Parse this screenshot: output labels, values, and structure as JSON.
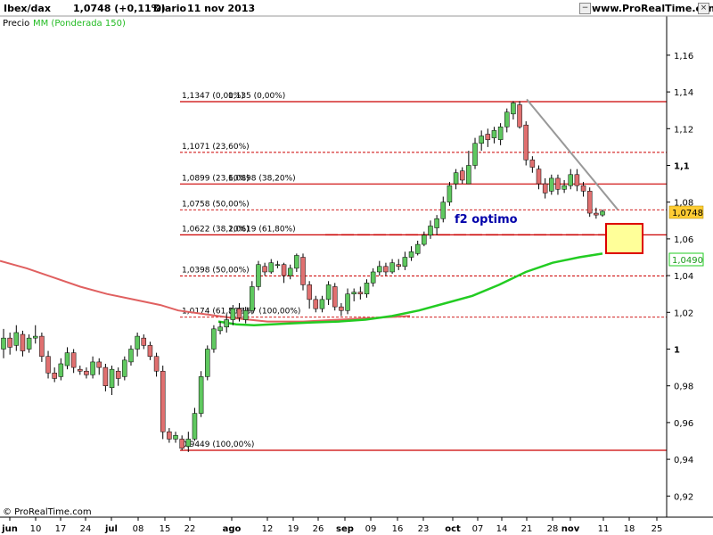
{
  "header": {
    "symbol": "Ibex/dax",
    "last": "1,0748 (+0,11%)",
    "period": "Diario",
    "date": "11 nov 2013",
    "site": "www.ProRealTime.com"
  },
  "legend": {
    "price_label": "Precio",
    "ma_label": "MM (Ponderada 150)"
  },
  "footer": {
    "copyright": "© ProRealTime.com"
  },
  "colors": {
    "up": "#5fc85f",
    "down": "#e07070",
    "level_line": "#cc0000",
    "ma_short": "#22cc22",
    "ma_long": "#e06060",
    "trend": "#999999",
    "highlight_fill": "#ffff99",
    "highlight_border": "#dd0000",
    "annotation": "#0000aa",
    "price_tag": "#ffcc33"
  },
  "chart_data": {
    "type": "candlestick",
    "ylim": [
      0.905,
      1.175
    ],
    "x_ticks": [
      "jun",
      "10",
      "17",
      "24",
      "jul",
      "08",
      "15",
      "22",
      "ago",
      "12",
      "19",
      "26",
      "sep",
      "09",
      "16",
      "23",
      "oct",
      "07",
      "14",
      "21",
      "28",
      "nov",
      "11",
      "18",
      "25"
    ],
    "bold_ticks": [
      "jun",
      "jul",
      "ago",
      "sep",
      "oct",
      "nov"
    ],
    "y_ticks": [
      "1,16",
      "1,14",
      "1,12",
      "1,1",
      "1,08",
      "1,06",
      "1,04",
      "1,02",
      "1",
      "0,98",
      "0,96",
      "0,94",
      "0,92"
    ],
    "y_tick_values": [
      1.16,
      1.14,
      1.12,
      1.1,
      1.08,
      1.06,
      1.04,
      1.02,
      1.0,
      0.98,
      0.96,
      0.94,
      0.92
    ],
    "candles": [
      [
        1.0,
        1.006,
        1.011,
        0.995
      ],
      [
        1.006,
        1.001,
        1.009,
        0.997
      ],
      [
        1.002,
        1.009,
        1.013,
        0.999
      ],
      [
        1.008,
        0.999,
        1.01,
        0.996
      ],
      [
        1.0,
        1.006,
        1.008,
        0.998
      ],
      [
        1.006,
        1.007,
        1.013,
        1.003
      ],
      [
        1.007,
        0.996,
        1.009,
        0.993
      ],
      [
        0.996,
        0.987,
        0.999,
        0.984
      ],
      [
        0.987,
        0.984,
        0.99,
        0.982
      ],
      [
        0.985,
        0.992,
        0.995,
        0.983
      ],
      [
        0.991,
        0.998,
        1.001,
        0.989
      ],
      [
        0.998,
        0.99,
        1.0,
        0.987
      ],
      [
        0.989,
        0.988,
        0.991,
        0.986
      ],
      [
        0.988,
        0.986,
        0.99,
        0.984
      ],
      [
        0.986,
        0.993,
        0.996,
        0.984
      ],
      [
        0.993,
        0.99,
        0.995,
        0.986
      ],
      [
        0.99,
        0.98,
        0.992,
        0.977
      ],
      [
        0.979,
        0.989,
        0.991,
        0.975
      ],
      [
        0.988,
        0.984,
        0.99,
        0.98
      ],
      [
        0.985,
        0.994,
        0.996,
        0.983
      ],
      [
        0.993,
        1.0,
        1.002,
        0.991
      ],
      [
        1.0,
        1.007,
        1.009,
        0.996
      ],
      [
        1.006,
        1.002,
        1.008,
        1.0
      ],
      [
        1.002,
        0.996,
        1.004,
        0.994
      ],
      [
        0.996,
        0.988,
        0.998,
        0.985
      ],
      [
        0.988,
        0.955,
        0.991,
        0.951
      ],
      [
        0.955,
        0.951,
        0.957,
        0.949
      ],
      [
        0.951,
        0.953,
        0.955,
        0.949
      ],
      [
        0.951,
        0.946,
        0.953,
        0.945
      ],
      [
        0.947,
        0.951,
        0.955,
        0.944
      ],
      [
        0.951,
        0.965,
        0.968,
        0.95
      ],
      [
        0.965,
        0.985,
        0.988,
        0.963
      ],
      [
        0.985,
        1.0,
        1.002,
        0.983
      ],
      [
        1.0,
        1.011,
        1.013,
        0.998
      ],
      [
        1.01,
        1.012,
        1.015,
        1.008
      ],
      [
        1.012,
        1.016,
        1.019,
        1.009
      ],
      [
        1.016,
        1.022,
        1.024,
        1.013
      ],
      [
        1.022,
        1.017,
        1.025,
        1.015
      ],
      [
        1.016,
        1.021,
        1.023,
        1.014
      ],
      [
        1.021,
        1.034,
        1.037,
        1.019
      ],
      [
        1.034,
        1.046,
        1.048,
        1.032
      ],
      [
        1.045,
        1.042,
        1.047,
        1.04
      ],
      [
        1.042,
        1.047,
        1.049,
        1.041
      ],
      [
        1.046,
        1.046,
        1.048,
        1.044
      ],
      [
        1.046,
        1.04,
        1.047,
        1.036
      ],
      [
        1.04,
        1.044,
        1.046,
        1.038
      ],
      [
        1.044,
        1.051,
        1.052,
        1.042
      ],
      [
        1.05,
        1.035,
        1.052,
        1.032
      ],
      [
        1.035,
        1.027,
        1.037,
        1.022
      ],
      [
        1.027,
        1.022,
        1.029,
        1.02
      ],
      [
        1.022,
        1.027,
        1.029,
        1.02
      ],
      [
        1.027,
        1.035,
        1.037,
        1.024
      ],
      [
        1.034,
        1.023,
        1.036,
        1.021
      ],
      [
        1.023,
        1.021,
        1.025,
        1.018
      ],
      [
        1.021,
        1.03,
        1.033,
        1.019
      ],
      [
        1.03,
        1.031,
        1.033,
        1.026
      ],
      [
        1.031,
        1.03,
        1.034,
        1.027
      ],
      [
        1.03,
        1.036,
        1.038,
        1.028
      ],
      [
        1.036,
        1.042,
        1.044,
        1.034
      ],
      [
        1.042,
        1.045,
        1.048,
        1.04
      ],
      [
        1.045,
        1.042,
        1.047,
        1.04
      ],
      [
        1.042,
        1.047,
        1.049,
        1.041
      ],
      [
        1.046,
        1.045,
        1.049,
        1.043
      ],
      [
        1.045,
        1.05,
        1.053,
        1.043
      ],
      [
        1.05,
        1.053,
        1.056,
        1.048
      ],
      [
        1.052,
        1.057,
        1.059,
        1.051
      ],
      [
        1.057,
        1.062,
        1.064,
        1.056
      ],
      [
        1.062,
        1.067,
        1.07,
        1.06
      ],
      [
        1.066,
        1.071,
        1.073,
        1.062
      ],
      [
        1.071,
        1.08,
        1.083,
        1.069
      ],
      [
        1.08,
        1.089,
        1.091,
        1.078
      ],
      [
        1.09,
        1.096,
        1.098,
        1.087
      ],
      [
        1.097,
        1.092,
        1.099,
        1.09
      ],
      [
        1.09,
        1.1,
        1.108,
        1.09
      ],
      [
        1.1,
        1.112,
        1.115,
        1.098
      ],
      [
        1.112,
        1.116,
        1.119,
        1.108
      ],
      [
        1.117,
        1.114,
        1.12,
        1.11
      ],
      [
        1.115,
        1.119,
        1.121,
        1.112
      ],
      [
        1.114,
        1.121,
        1.123,
        1.111
      ],
      [
        1.121,
        1.129,
        1.131,
        1.118
      ],
      [
        1.128,
        1.134,
        1.135,
        1.125
      ],
      [
        1.133,
        1.121,
        1.135,
        1.12
      ],
      [
        1.122,
        1.103,
        1.124,
        1.1
      ],
      [
        1.103,
        1.099,
        1.105,
        1.096
      ],
      [
        1.098,
        1.09,
        1.1,
        1.087
      ],
      [
        1.09,
        1.085,
        1.093,
        1.082
      ],
      [
        1.086,
        1.093,
        1.095,
        1.084
      ],
      [
        1.093,
        1.087,
        1.095,
        1.084
      ],
      [
        1.087,
        1.089,
        1.092,
        1.085
      ],
      [
        1.089,
        1.095,
        1.098,
        1.087
      ],
      [
        1.095,
        1.089,
        1.098,
        1.086
      ],
      [
        1.089,
        1.086,
        1.091,
        1.083
      ],
      [
        1.086,
        1.074,
        1.088,
        1.072
      ],
      [
        1.074,
        1.073,
        1.077,
        1.071
      ],
      [
        1.073,
        1.075,
        1.076,
        1.072
      ]
    ],
    "ma_long": [
      [
        0,
        1.048
      ],
      [
        30,
        1.044
      ],
      [
        60,
        1.039
      ],
      [
        90,
        1.034
      ],
      [
        120,
        1.03
      ],
      [
        150,
        1.027
      ],
      [
        180,
        1.024
      ],
      [
        200,
        1.021
      ],
      [
        230,
        1.019
      ],
      [
        260,
        1.017
      ],
      [
        300,
        1.015
      ],
      [
        340,
        1.015
      ],
      [
        380,
        1.016
      ],
      [
        420,
        1.017
      ],
      [
        460,
        1.018
      ]
    ],
    "ma_short": [
      [
        245,
        1.015
      ],
      [
        265,
        1.0135
      ],
      [
        285,
        1.013
      ],
      [
        305,
        1.0135
      ],
      [
        325,
        1.014
      ],
      [
        350,
        1.0145
      ],
      [
        380,
        1.015
      ],
      [
        410,
        1.016
      ],
      [
        440,
        1.018
      ],
      [
        470,
        1.021
      ],
      [
        500,
        1.025
      ],
      [
        530,
        1.029
      ],
      [
        560,
        1.035
      ],
      [
        590,
        1.042
      ],
      [
        620,
        1.047
      ],
      [
        650,
        1.05
      ],
      [
        676,
        1.052
      ]
    ],
    "trendline": [
      [
        591,
        1.136
      ],
      [
        693,
        1.076
      ]
    ],
    "levels": [
      {
        "value": 1.1347,
        "style": "solid",
        "label": "1,1347 (0,00%)",
        "label2": "1,135 (0,00%)"
      },
      {
        "value": 1.1071,
        "style": "dashed",
        "label": "1,1071 (23,60%)"
      },
      {
        "value": 1.0899,
        "style": "solid",
        "label": "1,0899 (23,60%)",
        "label2": "1,0898 (38,20%)"
      },
      {
        "value": 1.0758,
        "style": "dashed",
        "label": "1,0758 (50,00%)"
      },
      {
        "value": 1.0622,
        "style": "solid",
        "label": "1,0622 (38,20%)",
        "label2": "1,0619 (61,80%)"
      },
      {
        "value": 1.0398,
        "style": "dashed",
        "label": "1,0398 (50,00%)"
      },
      {
        "value": 1.0174,
        "style": "dashed",
        "label": "1,0174 (61,80%)",
        "label2": "1,0187 (100,00%)"
      },
      {
        "value": 0.9449,
        "style": "solid",
        "label": "0,9449 (100,00%)"
      }
    ],
    "annotation": "f2 optimo",
    "price_tag": "1,0748",
    "ma_tag": "1,0490"
  }
}
